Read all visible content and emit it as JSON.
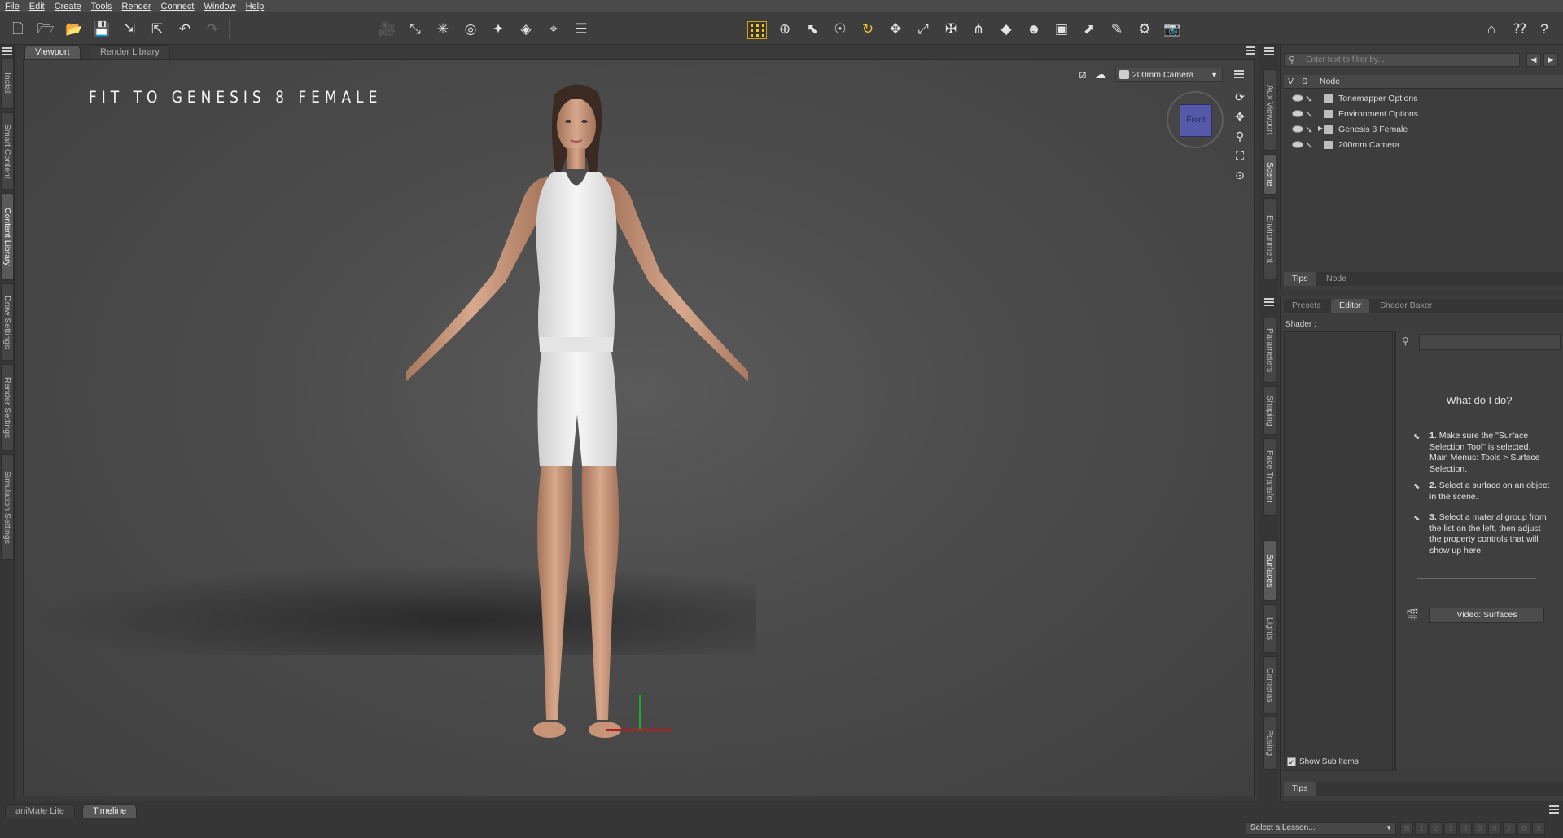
{
  "menubar": {
    "items": [
      "File",
      "Edit",
      "Create",
      "Tools",
      "Render",
      "Connect",
      "Window",
      "Help"
    ]
  },
  "viewport_tabs": [
    "Viewport",
    "Render Library"
  ],
  "viewport": {
    "title": "FIT TO GENESIS 8 FEMALE",
    "camera": "200mm Camera",
    "cube_face": "Front"
  },
  "left_tabs": [
    "Install",
    "Smart Content",
    "Content Library",
    "Draw Settings",
    "Render Settings",
    "Simulation Settings"
  ],
  "left_active_tab": "Content Library",
  "right_tabs_top": [
    "Aux Viewport",
    "Scene",
    "Environment"
  ],
  "right_tabs_bottom": [
    "Parameters",
    "Shaping",
    "Face Transfer",
    "Surfaces",
    "Lights",
    "Cameras",
    "Posing"
  ],
  "scene": {
    "filter_placeholder": "Enter text to filter by...",
    "columns": [
      "V",
      "S",
      "Node"
    ],
    "nodes": [
      {
        "label": "Tonemapper Options",
        "icon": "tonemapper-icon",
        "expandable": false
      },
      {
        "label": "Environment Options",
        "icon": "environment-icon",
        "expandable": false
      },
      {
        "label": "Genesis 8 Female",
        "icon": "figure-icon",
        "expandable": true
      },
      {
        "label": "200mm Camera",
        "icon": "camera-icon",
        "expandable": false
      }
    ],
    "bottom_tabs": [
      "Tips",
      "Node"
    ]
  },
  "surfaces": {
    "tabs": [
      "Presets",
      "Editor",
      "Shader Baker"
    ],
    "active_tab": "Editor",
    "shader_label": "Shader :",
    "help_title": "What do I do?",
    "steps": [
      {
        "num": "1.",
        "text": "Make sure the \"Surface Selection Tool\" is selected. Main Menus: Tools > Surface Selection."
      },
      {
        "num": "2.",
        "text": "Select a surface on an object in the scene."
      },
      {
        "num": "3.",
        "text": "Select a material group from the list on the left, then adjust the property controls that will show up here."
      }
    ],
    "video_button": "Video: Surfaces",
    "show_sub_items": "Show Sub Items",
    "show_sub_checked": true,
    "bottom_tabs": [
      "Tips"
    ]
  },
  "bottom": {
    "tabs": [
      "aniMate Lite",
      "Timeline"
    ],
    "active_tab": "Timeline",
    "lesson_select": "Select a Lesson...",
    "lesson_numbers": [
      "1",
      "2",
      "3",
      "4",
      "5",
      "6",
      "7",
      "8",
      "9"
    ]
  },
  "colors": {
    "accent": "#f2c230",
    "panel_bg": "#3d3d3d",
    "viewport_bg": "#4b4b4b"
  }
}
